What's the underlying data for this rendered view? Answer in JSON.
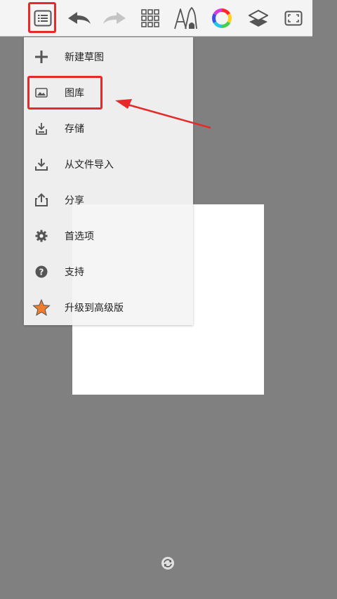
{
  "toolbar": {
    "buttons": [
      {
        "name": "menu-list-icon"
      },
      {
        "name": "undo-icon"
      },
      {
        "name": "redo-icon"
      },
      {
        "name": "grid-icon"
      },
      {
        "name": "brush-pen-icon"
      },
      {
        "name": "color-wheel-icon"
      },
      {
        "name": "layers-icon"
      },
      {
        "name": "fullscreen-icon"
      }
    ],
    "highlight_color": "#e52a2a"
  },
  "menu": {
    "items": [
      {
        "label": "新建草图",
        "icon": "plus-icon"
      },
      {
        "label": "图库",
        "icon": "gallery-icon"
      },
      {
        "label": "存储",
        "icon": "save-icon"
      },
      {
        "label": "从文件导入",
        "icon": "import-icon"
      },
      {
        "label": "分享",
        "icon": "share-icon"
      },
      {
        "label": "首选项",
        "icon": "gear-icon"
      },
      {
        "label": "支持",
        "icon": "help-icon"
      },
      {
        "label": "升级到高级版",
        "icon": "star-icon"
      }
    ]
  },
  "colors": {
    "background": "#808080",
    "toolbar": "#f4f4f4",
    "menu": "#f4f4f4",
    "accent_star": "#f07c2c",
    "annotation": "#e52a2a"
  }
}
